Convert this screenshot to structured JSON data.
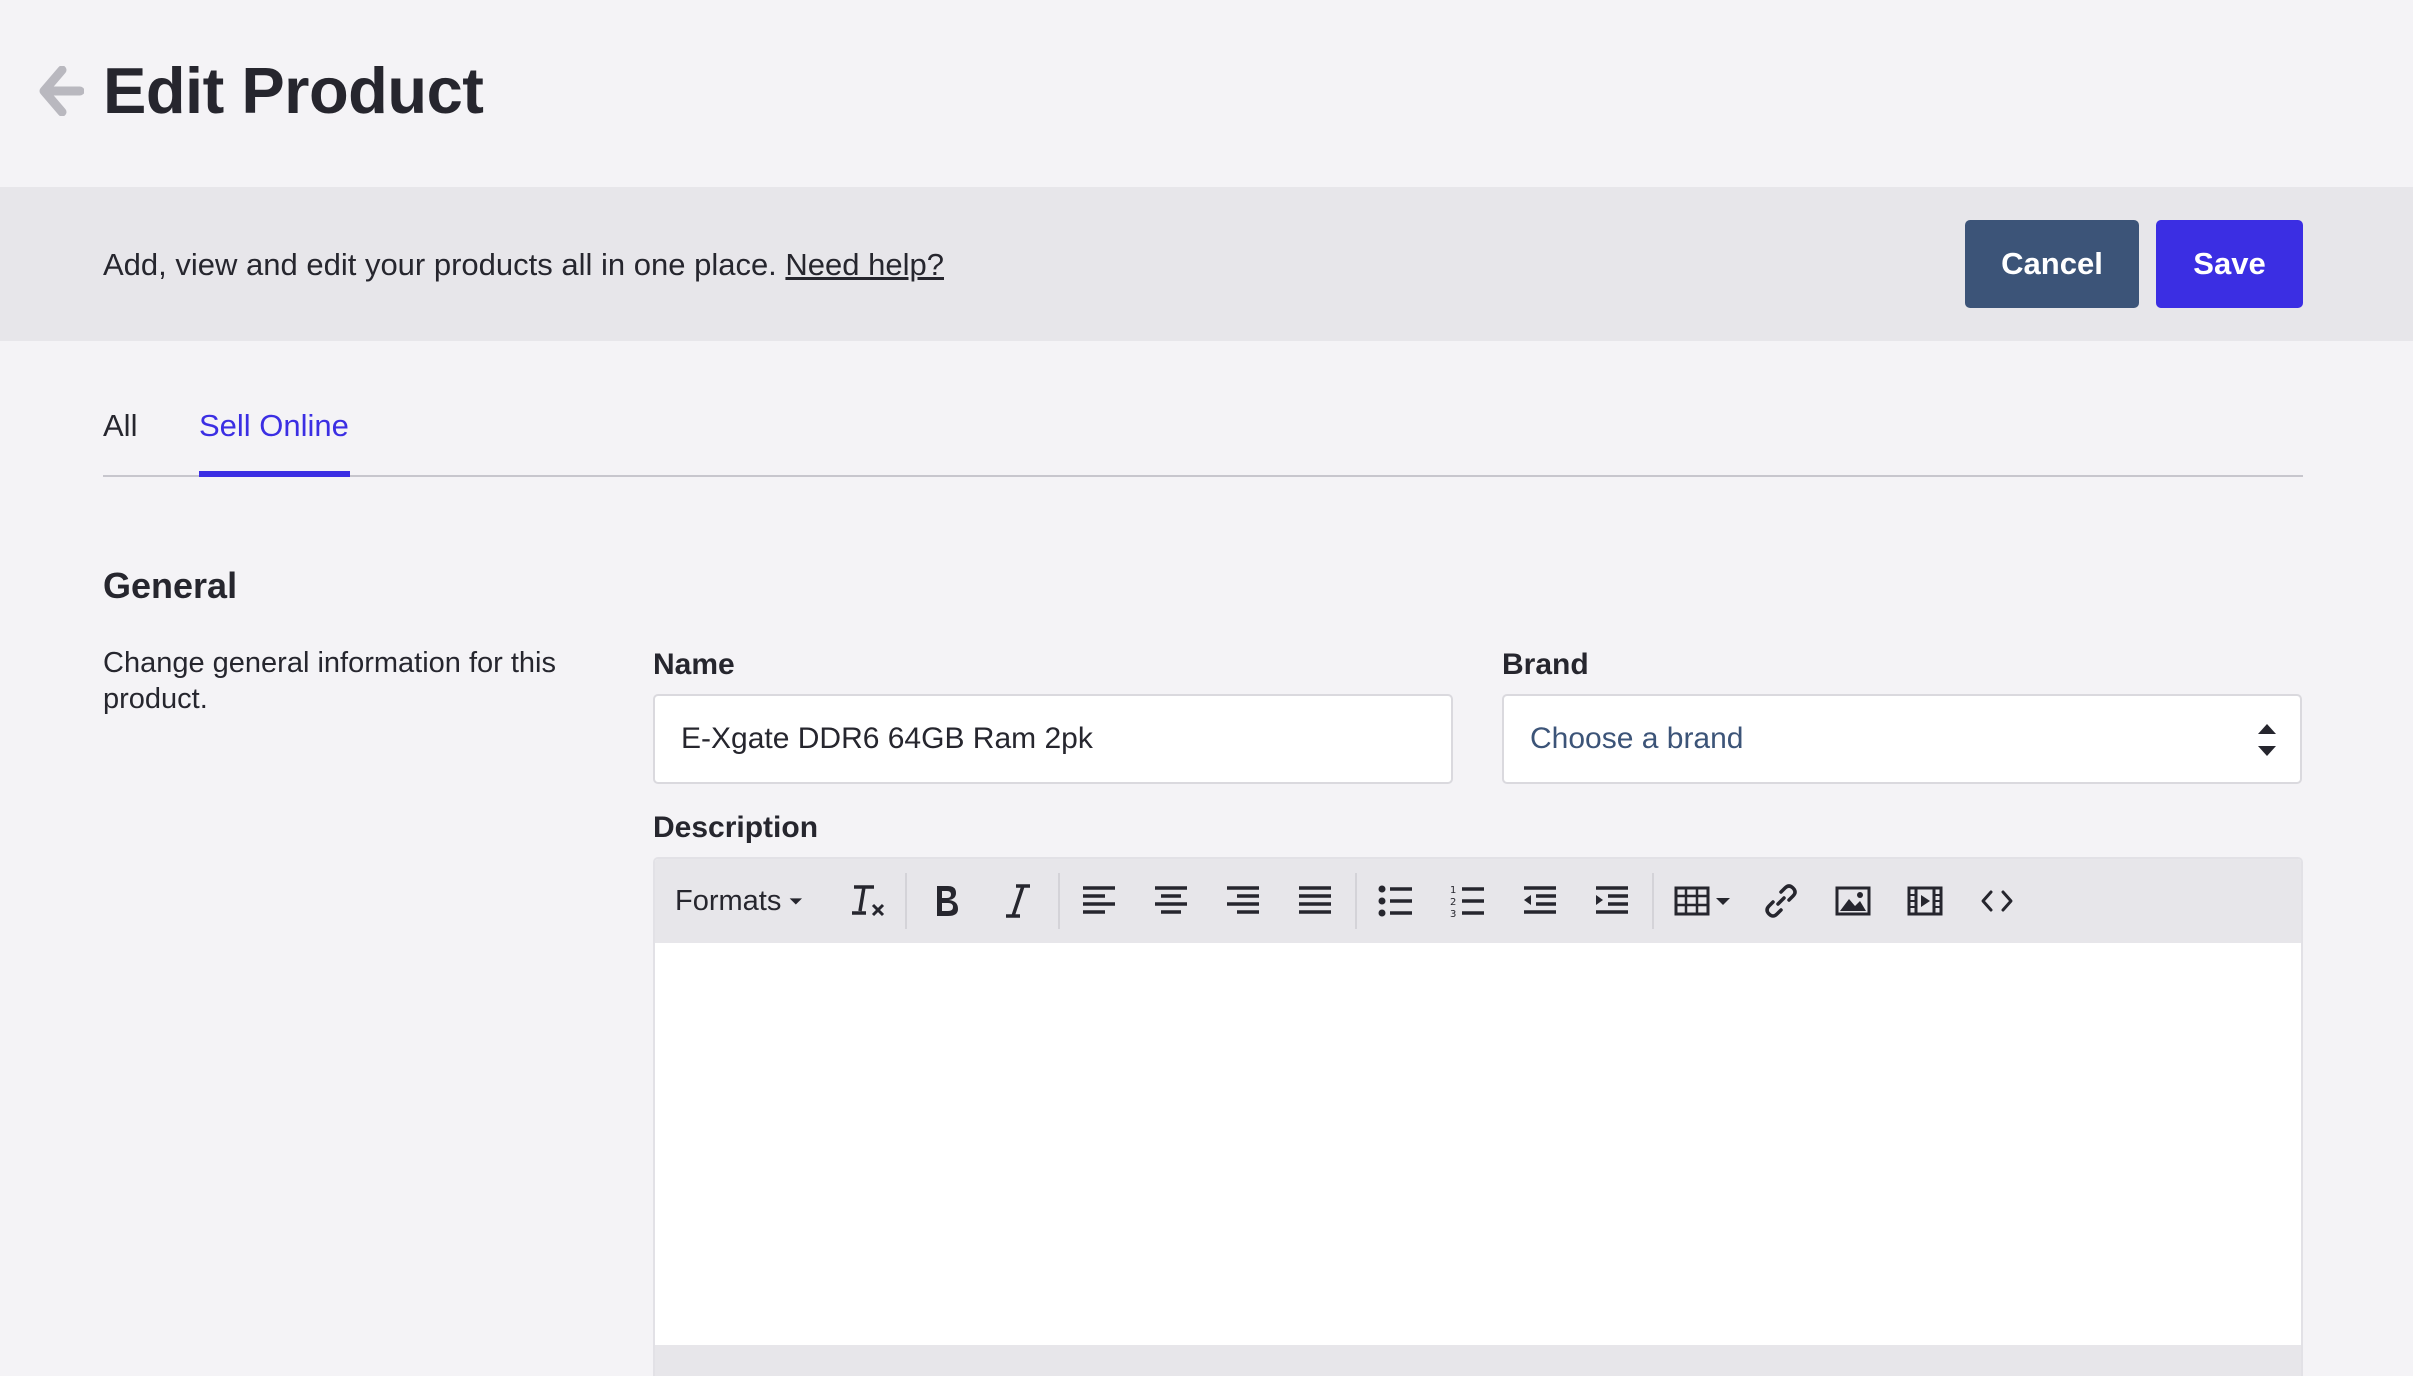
{
  "header": {
    "title": "Edit Product",
    "back_icon": "arrow-left-icon"
  },
  "info_bar": {
    "text": "Add, view and edit your products all in one place.",
    "help_link": "Need help?",
    "cancel_label": "Cancel",
    "save_label": "Save"
  },
  "tabs": [
    {
      "label": "All",
      "active": false
    },
    {
      "label": "Sell Online",
      "active": true
    }
  ],
  "general": {
    "title": "General",
    "description": "Change general information for this product.",
    "name_label": "Name",
    "name_value": "E-Xgate DDR6 64GB Ram 2pk",
    "brand_label": "Brand",
    "brand_placeholder": "Choose a brand",
    "description_label": "Description"
  },
  "editor": {
    "formats_label": "Formats",
    "toolbar_icons": [
      "clear-formatting-icon",
      "bold-icon",
      "italic-icon",
      "align-left-icon",
      "align-center-icon",
      "align-right-icon",
      "align-justify-icon",
      "bullet-list-icon",
      "numbered-list-icon",
      "outdent-icon",
      "indent-icon",
      "table-icon",
      "link-icon",
      "image-icon",
      "media-icon",
      "source-code-icon"
    ]
  },
  "colors": {
    "primary": "#3b2ee3",
    "secondary": "#3c5478",
    "background": "#f4f3f6",
    "bar": "#e7e6ea"
  }
}
